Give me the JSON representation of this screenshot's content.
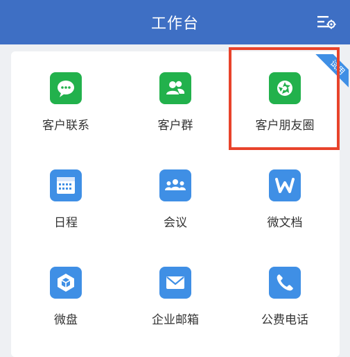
{
  "header": {
    "title": "工作台"
  },
  "apps": [
    {
      "label": "客户联系",
      "icon": "wechat-chat-icon",
      "color": "#22b14c"
    },
    {
      "label": "客户群",
      "icon": "group-users-icon",
      "color": "#22b14c"
    },
    {
      "label": "客户朋友圈",
      "icon": "moments-aperture-icon",
      "color": "#22b14c",
      "badge": "试用"
    },
    {
      "label": "日程",
      "icon": "calendar-icon",
      "color": "#3f8fe5"
    },
    {
      "label": "会议",
      "icon": "meeting-people-icon",
      "color": "#3f8fe5"
    },
    {
      "label": "微文档",
      "icon": "document-w-icon",
      "color": "#3f8fe5"
    },
    {
      "label": "微盘",
      "icon": "cloud-drive-icon",
      "color": "#3f8fe5"
    },
    {
      "label": "企业邮箱",
      "icon": "mail-envelope-icon",
      "color": "#3f8fe5"
    },
    {
      "label": "公费电话",
      "icon": "phone-handset-icon",
      "color": "#3f8fe5"
    }
  ],
  "colors": {
    "header_bg": "#3e6fc4",
    "green": "#22b14c",
    "blue": "#3f8fe5",
    "highlight_border": "#e8432b"
  }
}
